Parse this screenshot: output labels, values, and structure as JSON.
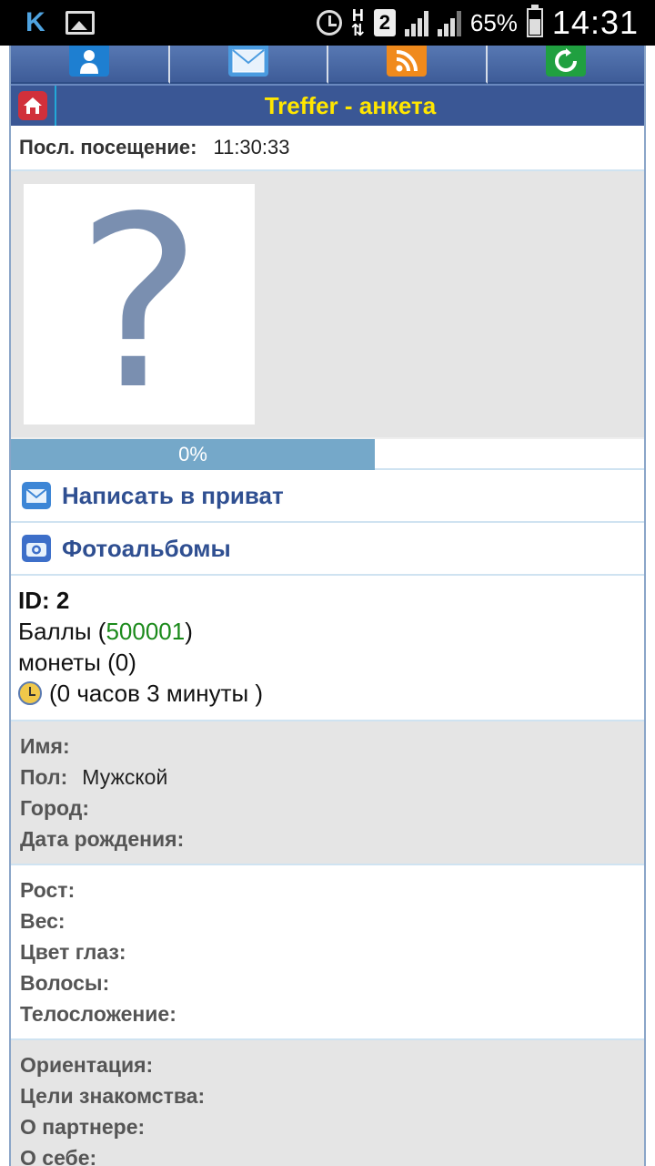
{
  "status_bar": {
    "app_letter": "K",
    "network_h": "H",
    "sim_number": "2",
    "battery_percent": "65%",
    "time": "14:31"
  },
  "nav_tabs": [
    {
      "name": "profile",
      "icon": "user-icon",
      "color": "#1e7fd1"
    },
    {
      "name": "mail",
      "icon": "envelope-icon",
      "color": "#4a9be0"
    },
    {
      "name": "rss",
      "icon": "rss-icon",
      "color": "#f08a1c"
    },
    {
      "name": "refresh",
      "icon": "refresh-icon",
      "color": "#20a040"
    }
  ],
  "header": {
    "title": "Treffer - анкета",
    "title_color": "#ffe600"
  },
  "last_visit": {
    "label": "Посл. посещение:",
    "value": "11:30:33"
  },
  "photo": {
    "placeholder": "?"
  },
  "progress": {
    "label": "0%",
    "value": 0
  },
  "actions": {
    "write_private": "Написать в приват",
    "photo_albums": "Фотоальбомы"
  },
  "stats": {
    "id_label": "ID: 2",
    "points_prefix": "Баллы (",
    "points_value": "500001",
    "points_suffix": ")",
    "coins": "монеты (0)",
    "online_time": "(0 часов 3 минуты )"
  },
  "basic_info": {
    "name_label": "Имя:",
    "gender_label": "Пол:",
    "gender_value": "Мужской",
    "city_label": "Город:",
    "birthdate_label": "Дата рождения:"
  },
  "body_info": {
    "height_label": "Рост:",
    "weight_label": "Вес:",
    "eye_color_label": "Цвет глаз:",
    "hair_label": "Волосы:",
    "build_label": "Телосложение:"
  },
  "dating_info": {
    "orientation_label": "Ориентация:",
    "goals_label": "Цели знакомства:",
    "about_partner_label": "О партнере:",
    "about_self_label": "О себе:"
  }
}
